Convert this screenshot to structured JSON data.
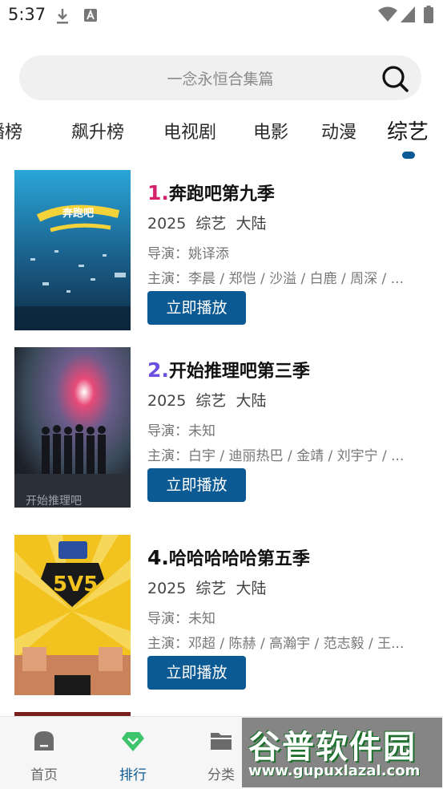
{
  "status_bar": {
    "time": "5:37"
  },
  "search": {
    "placeholder": "一念永恒合集篇"
  },
  "tabs": [
    {
      "label": "播榜",
      "active": false
    },
    {
      "label": "飙升榜",
      "active": false
    },
    {
      "label": "电视剧",
      "active": false
    },
    {
      "label": "电影",
      "active": false
    },
    {
      "label": "动漫",
      "active": false
    },
    {
      "label": "综艺",
      "active": true
    }
  ],
  "list": [
    {
      "rank": "1.",
      "rank_color": "#d6226b",
      "title": "奔跑吧第九季",
      "year": "2025",
      "genre": "综艺",
      "region": "大陆",
      "director": "导演：姚译添",
      "cast": "主演：李晨 / 郑恺 / 沙溢 / 白鹿 / 周深 / ...",
      "play_label": "立即播放",
      "poster_text": "奔跑吧"
    },
    {
      "rank": "2.",
      "rank_color": "#6a4fe0",
      "title": "开始推理吧第三季",
      "year": "2025",
      "genre": "综艺",
      "region": "大陆",
      "director": "导演：未知",
      "cast": "主演：白宇 / 迪丽热巴 / 金靖 / 刘宇宁 / ...",
      "play_label": "立即播放",
      "poster_text": "开始推理吧"
    },
    {
      "rank": "4.",
      "rank_color": "#111111",
      "title": "哈哈哈哈哈第五季",
      "year": "2025",
      "genre": "综艺",
      "region": "大陆",
      "director": "导演：未知",
      "cast": "主演：邓超 / 陈赫 / 高瀚宇 / 范志毅 / 王...",
      "play_label": "立即播放",
      "poster_text": "5V5"
    }
  ],
  "bottom_nav": [
    {
      "label": "首页",
      "icon": "home-icon",
      "active": false
    },
    {
      "label": "排行",
      "icon": "rank-icon",
      "active": true
    },
    {
      "label": "分类",
      "icon": "folder-icon",
      "active": false
    }
  ],
  "watermark": {
    "main": "谷普软件园",
    "sub": "www.gupuxlazal.com"
  },
  "colors": {
    "accent": "#0b5a93",
    "rank_active": "#3ec46d"
  }
}
